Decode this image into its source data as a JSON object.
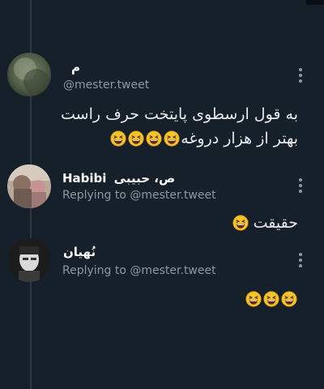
{
  "thread": {
    "tweets": [
      {
        "name": "م",
        "handle": "@mester.tweet",
        "text_line1": "به قول ارسطوی پایتخت حرف راست",
        "text_line2": "بهتر از هزار دروغه",
        "emoji_count": 4
      },
      {
        "name_prefix": "ص، حبیبی",
        "name_main": "Habibi",
        "replying_to": "Replying to @mester.tweet",
        "text": "حقیقت",
        "emoji_count": 1
      },
      {
        "name": "نُهیان",
        "replying_to": "Replying to @mester.tweet",
        "text": "",
        "emoji_count": 3
      }
    ]
  },
  "icons": {
    "more": "more-vertical-icon",
    "emoji": "grinning-squinting-face-emoji"
  },
  "colors": {
    "background": "#16202a",
    "text": "#e7e9ea",
    "secondary_text": "#8b98a5",
    "thread_line": "#2b3640",
    "emoji_face": "#f7c52b"
  }
}
